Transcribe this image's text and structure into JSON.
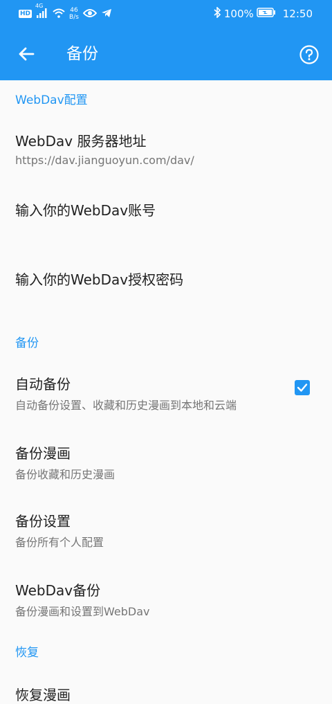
{
  "status_bar": {
    "hd": "HD",
    "net_type": "4G",
    "speed_value": "46",
    "speed_unit": "B/s",
    "battery": "100%",
    "time": "12:50"
  },
  "app_bar": {
    "title": "备份"
  },
  "sections": {
    "webdav": {
      "header": "WebDav配置",
      "server_title": "WebDav 服务器地址",
      "server_summary": "https://dav.jianguoyun.com/dav/",
      "account_title": "输入你的WebDav账号",
      "password_title": "输入你的WebDav授权密码"
    },
    "backup": {
      "header": "备份",
      "auto_title": "自动备份",
      "auto_summary": "自动备份设置、收藏和历史漫画到本地和云端",
      "auto_checked": true,
      "comic_title": "备份漫画",
      "comic_summary": "备份收藏和历史漫画",
      "settings_title": "备份设置",
      "settings_summary": "备份所有个人配置",
      "webdav_title": "WebDav备份",
      "webdav_summary": "备份漫画和设置到WebDav"
    },
    "restore": {
      "header": "恢复",
      "comic_title": "恢复漫画"
    }
  },
  "colors": {
    "primary": "#2196f3",
    "background": "#fafafa",
    "title_text": "#212121",
    "summary_text": "#757575"
  }
}
